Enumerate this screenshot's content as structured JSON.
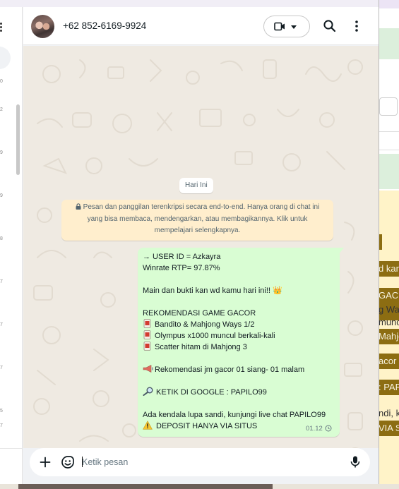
{
  "background_window": {
    "snippets": [
      "d kam",
      "GAC",
      "g Wa",
      "muncul",
      "Mahjor",
      "acor",
      ": PAP",
      "ndi, ku",
      "VIA SI"
    ]
  },
  "left_panel": {
    "times": [
      "0",
      "2",
      "9",
      "9",
      "8",
      "7",
      "7",
      "7",
      "5",
      "7"
    ]
  },
  "chat": {
    "contact_name": "+62 852-6169-9924",
    "date_chip": "Hari Ini",
    "encryption_notice": "Pesan dan panggilan terenkripsi secara end-to-end. Hanya orang di chat ini yang bisa membaca, mendengarkan, atau membagikannya. Klik untuk mempelajari selengkapnya.",
    "message": {
      "lines": [
        "→ USER ID = Azkayra",
        "Winrate RTP= 97.87%",
        "",
        "Main dan bukti kan wd kamu hari ini!! 👑",
        "",
        "REKOMENDASI GAME GACOR",
        "Bandito & Mahjong Ways 1/2",
        "Olympus x1000 muncul berkali-kali",
        "Scatter hitam di Mahjong 3",
        "",
        "Rekomendasi jm gacor 01 siang- 01 malam",
        "",
        "KETIK DI GOOGLE : PAPILO99",
        "",
        "Ada kendala lupa sandi, kunjungi live chat PAPILO99",
        "DEPOSIT HANYA VIA SITUS"
      ],
      "time": "01.12"
    }
  },
  "composer": {
    "placeholder": "Ketik pesan"
  },
  "colors": {
    "bubble": "#d9fdd3",
    "chat_bg": "#efeae2",
    "notice_bg": "#ffeecd",
    "icon": "#54656f"
  },
  "icons": [
    "menu-dots-icon",
    "video-call-icon",
    "chevron-down-icon",
    "search-icon",
    "kebab-menu-icon",
    "lock-icon",
    "crown-emoji",
    "mahjong-tile-emoji",
    "megaphone-emoji",
    "magnifier-emoji",
    "warning-emoji",
    "clock-icon",
    "plus-icon",
    "emoji-icon",
    "microphone-icon"
  ]
}
